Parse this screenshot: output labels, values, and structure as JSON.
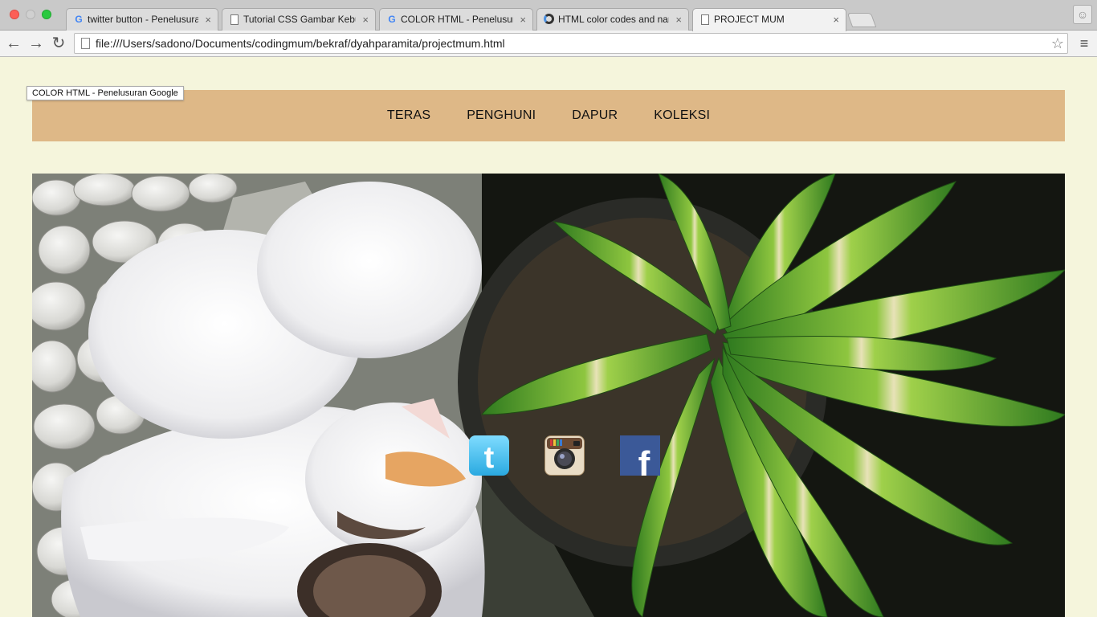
{
  "browser": {
    "tabs": [
      {
        "title": "twitter button - Penelusuran Google",
        "icon": "google-icon",
        "active": false
      },
      {
        "title": "Tutorial CSS Gambar Kebun",
        "icon": "document-icon",
        "active": false
      },
      {
        "title": "COLOR HTML - Penelusuran Google",
        "icon": "google-icon",
        "active": false
      },
      {
        "title": "HTML color codes and names",
        "icon": "loading-icon",
        "active": false
      },
      {
        "title": "PROJECT MUM",
        "icon": "document-icon",
        "active": true
      }
    ],
    "close_glyph": "×",
    "url": "file:///Users/sadono/Documents/codingmum/bekraf/dyahparamita/projectmum.html",
    "tooltip": "COLOR HTML - Penelusuran Google"
  },
  "nav": {
    "items": [
      "TERAS",
      "PENGHUNI",
      "DAPUR",
      "KOLEKSI"
    ]
  },
  "social": {
    "twitter_letter": "t",
    "facebook_letter": "f"
  },
  "colors": {
    "page_bg": "#f5f5dc",
    "navbar_bg": "#deb887"
  }
}
